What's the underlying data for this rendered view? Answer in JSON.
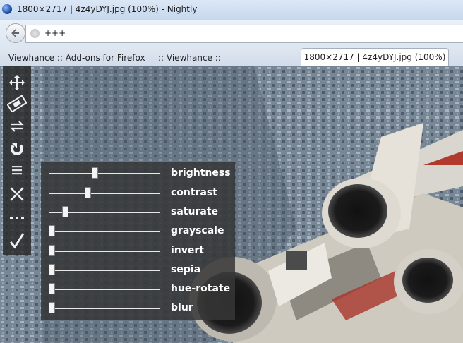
{
  "window": {
    "title": "1800×2717 | 4z4yDYJ.jpg (100%) - Nightly"
  },
  "navbar": {
    "url": "+++"
  },
  "tabs": [
    {
      "label": "Viewhance :: Add-ons for Firefox",
      "active": false
    },
    {
      "label": ":: Viewhance ::",
      "active": false
    },
    {
      "label": "1800×2717 | 4z4yDYJ.jpg (100%)",
      "active": true
    }
  ],
  "toolbar": {
    "tools": [
      {
        "icon": "move-icon"
      },
      {
        "icon": "fit-size-icon"
      },
      {
        "icon": "flip-icon"
      },
      {
        "icon": "rotate-icon"
      },
      {
        "icon": "menu-icon"
      },
      {
        "icon": "close-icon"
      },
      {
        "icon": "more-icon"
      },
      {
        "icon": "apply-check-icon"
      }
    ]
  },
  "filters": [
    {
      "label": "brightness",
      "level": 0.41
    },
    {
      "label": "contrast",
      "level": 0.34
    },
    {
      "label": "saturate",
      "level": 0.13
    },
    {
      "label": "grayscale",
      "level": 0.0
    },
    {
      "label": "invert",
      "level": 0.0
    },
    {
      "label": "sepia",
      "level": 0.0
    },
    {
      "label": "hue-rotate",
      "level": 0.0
    },
    {
      "label": "blur",
      "level": 0.0
    }
  ]
}
